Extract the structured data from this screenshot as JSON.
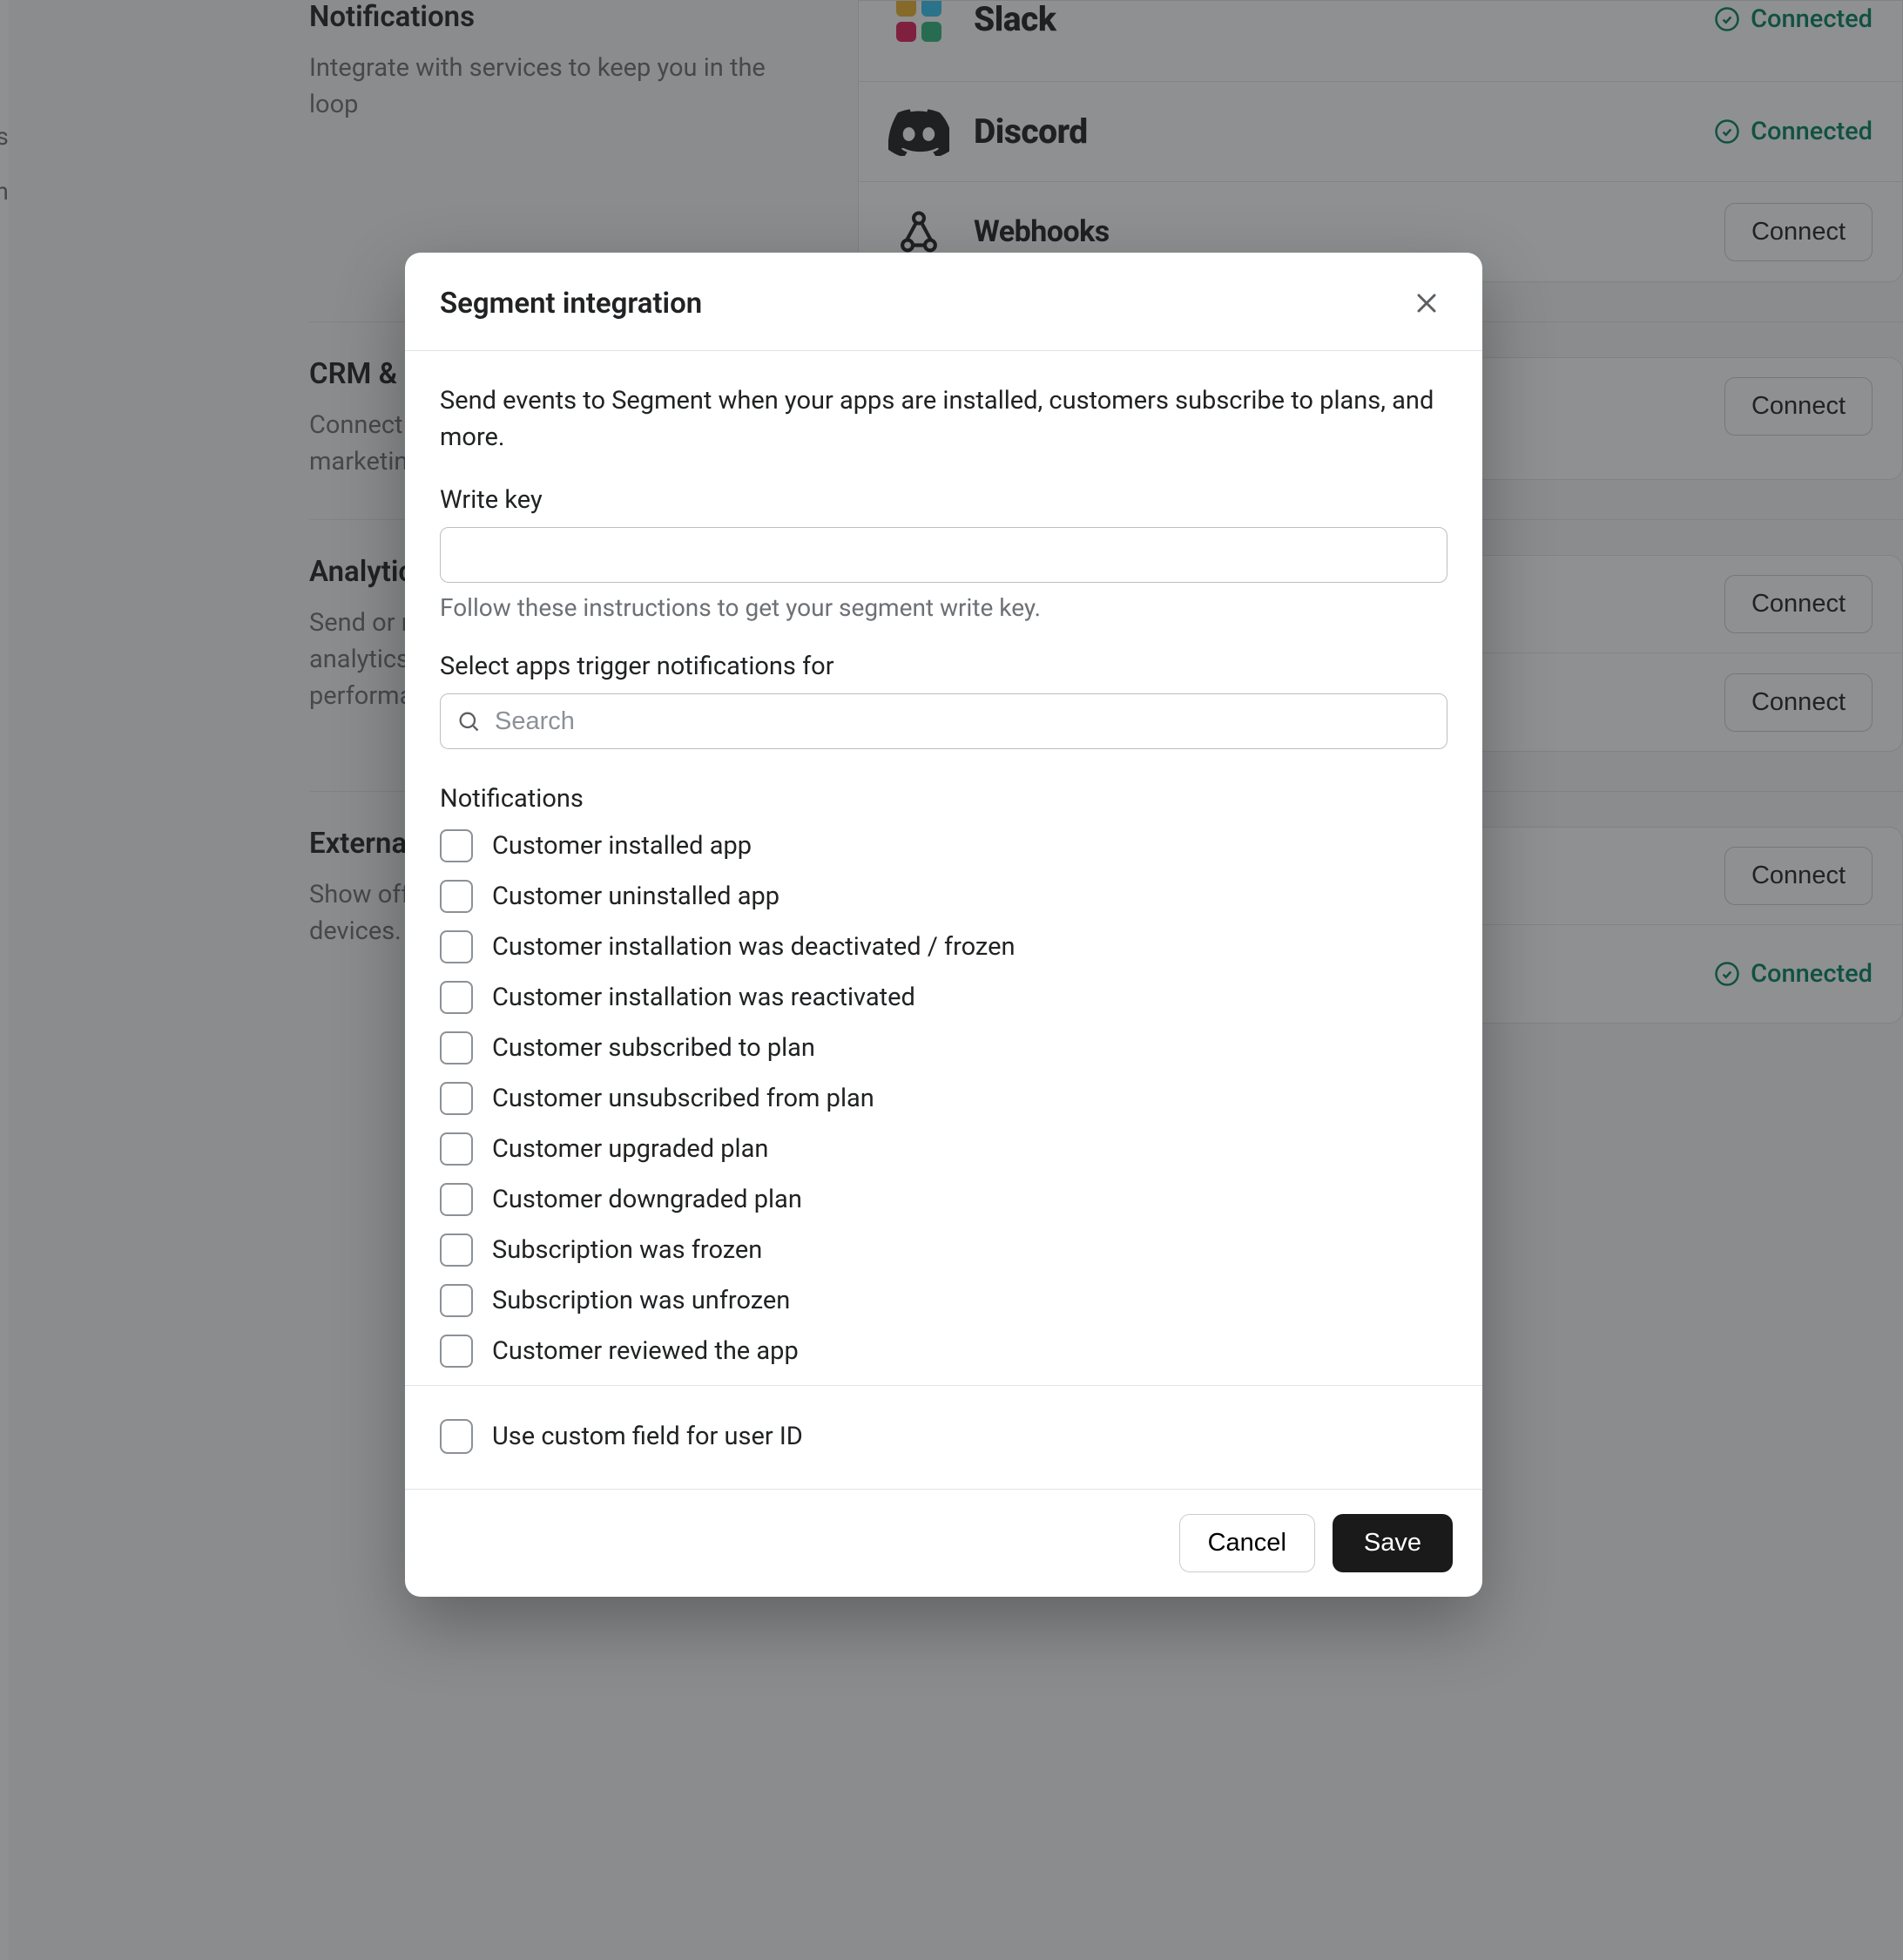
{
  "bg": {
    "sections": [
      {
        "title": "Notifications",
        "desc": "Integrate with services to keep you in the loop",
        "rows": [
          {
            "name": "Slack",
            "status": "Connected",
            "kind": "connected"
          },
          {
            "name": "Discord",
            "status": "Connected",
            "kind": "connected"
          },
          {
            "name": "Webhooks",
            "action": "Connect",
            "kind": "button"
          }
        ]
      },
      {
        "title": "CRM & Marketing",
        "desc": "Connect your customer data to CRM & marketing tools.",
        "rows": [
          {
            "action": "Connect",
            "kind": "button"
          }
        ]
      },
      {
        "title": "Analytics",
        "desc": "Send or receive events to third-party analytics tools to track app usage and performance.",
        "rows": [
          {
            "action": "Connect",
            "kind": "button"
          },
          {
            "action": "Connect",
            "kind": "button"
          }
        ]
      },
      {
        "title": "External Stores",
        "desc": "Show off your app on external stores and devices.",
        "rows": [
          {
            "action": "Connect",
            "kind": "button"
          },
          {
            "status": "Connected",
            "kind": "connected"
          }
        ]
      }
    ]
  },
  "modal": {
    "title": "Segment integration",
    "desc": "Send events to Segment when your apps are installed, customers subscribe to plans, and more.",
    "writekey": {
      "label": "Write key",
      "hint": "Follow these instructions to get your segment write key."
    },
    "apps": {
      "label": "Select apps trigger notifications for",
      "placeholder": "Search"
    },
    "notif_label": "Notifications",
    "notifs": [
      "Customer installed app",
      "Customer uninstalled app",
      "Customer installation was deactivated / frozen",
      "Customer installation was reactivated",
      "Customer subscribed to plan",
      "Customer unsubscribed from plan",
      "Customer upgraded plan",
      "Customer downgraded plan",
      "Subscription was frozen",
      "Subscription was unfrozen",
      "Customer reviewed the app"
    ],
    "custom_field": "Use custom field for user ID",
    "cancel": "Cancel",
    "save": "Save"
  }
}
